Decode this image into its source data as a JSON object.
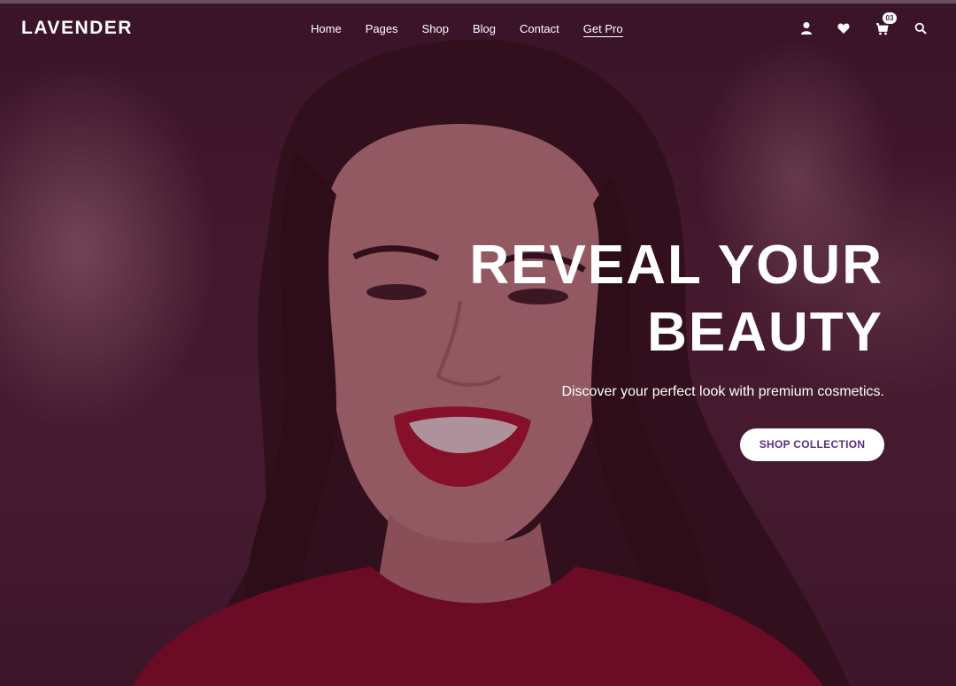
{
  "brand": {
    "logo_text": "LAVENDER"
  },
  "nav": {
    "items": [
      {
        "label": "Home"
      },
      {
        "label": "Pages"
      },
      {
        "label": "Shop"
      },
      {
        "label": "Blog"
      },
      {
        "label": "Contact"
      },
      {
        "label": "Get Pro",
        "active": true
      }
    ]
  },
  "header_icons": {
    "user": "user-icon",
    "wishlist": "heart-icon",
    "cart": "cart-icon",
    "search": "search-icon",
    "cart_count": "03"
  },
  "hero": {
    "title_line1": "REVEAL YOUR",
    "title_line2": "BEAUTY",
    "subtitle": "Discover your perfect look with premium cosmetics.",
    "cta_label": "SHOP COLLECTION"
  },
  "colors": {
    "accent_text": "#5b2c86",
    "overlay": "#3c0a28",
    "lip": "#b3122a",
    "top": "#8a0c24"
  }
}
